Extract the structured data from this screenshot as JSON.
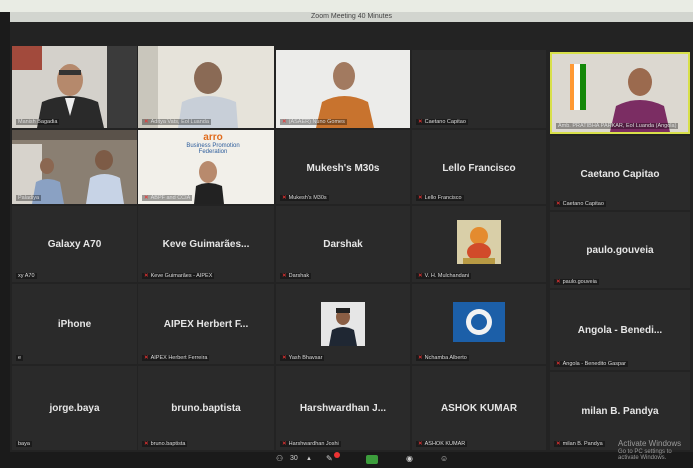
{
  "window": {
    "title": "Zoom Meeting 40 Minutes"
  },
  "participants": {
    "r1c1": "Manish Bagadia",
    "r1c2": "Aditya Vats, Eol Luanda",
    "r1c3": "(ASAER) Nuno Gomes",
    "r1c4": "Caetano Capitao",
    "r1c5": "Amb. PRATIBHA PARKAR, EoI Luanda (Angola)",
    "r2c1": "Paladiya",
    "r2c2": "ABPF and CCIA",
    "r2c2_banner_logo": "arro",
    "r2c2_banner_line1": "Business Promotion",
    "r2c2_banner_line2": "Federation",
    "r2c3_name": "Mukesh's M30s",
    "r2c3_label": "Mukesh's M30s",
    "r2c4_name": "Lello Francisco",
    "r2c4_label": "Lello Francisco",
    "r2c5_name": "Caetano Capitao",
    "r2c5_label": "Caetano Capitao",
    "r3c1_name": "Galaxy A70",
    "r3c1_label": "xy A70",
    "r3c2_name": "Keve Guimarães...",
    "r3c2_label": "Keve Guimarães - AIPEX",
    "r3c3_name": "Darshak",
    "r3c3_label": "Darshak",
    "r3c4_label": "V. H. Mulchandani",
    "r3c5_name": "paulo.gouveia",
    "r3c5_label": "paulo.gouveia",
    "r4c1_name": "iPhone",
    "r4c1_label": "e",
    "r4c2_name": "AIPEX Herbert F...",
    "r4c2_label": "AIPEX Herbert Ferreira",
    "r4c3_label": "Yash Bhavsar",
    "r4c4_label": "Nchamba Alberto",
    "r4c5_name": "Angola - Benedi...",
    "r4c5_label": "Angola - Benedito Gaspar",
    "r5c1_name": "jorge.baya",
    "r5c1_label": "baya",
    "r5c2_name": "bruno.baptista",
    "r5c2_label": "bruno.baptista",
    "r5c3_name": "Harshwardhan J...",
    "r5c3_label": "Harshwardhan Joshi",
    "r5c4_name": "ASHOK KUMAR",
    "r5c4_label": "ASHOK KUMAR",
    "r5c5_name": "milan B. Pandya",
    "r5c5_label": "milan B. Pandya"
  },
  "toolbar": {
    "participant_count": "30"
  },
  "watermark": {
    "line1": "Activate Windows",
    "line2": "Go to PC settings to activate Windows."
  },
  "colors": {
    "active_speaker": "#d8e04a",
    "muted_mic": "#e33333"
  }
}
